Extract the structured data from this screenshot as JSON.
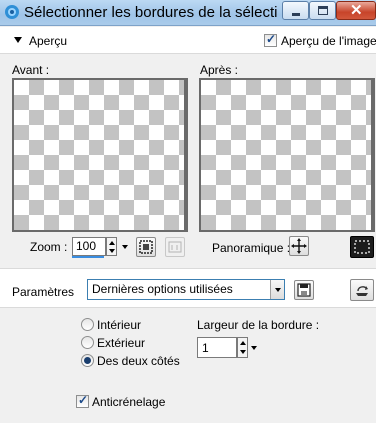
{
  "window": {
    "title": "Sélectionner les bordures de la sélecti",
    "close_glyph": "✕"
  },
  "preview": {
    "section_label": "Aperçu",
    "image_preview_label": "Aperçu de l'image",
    "image_preview_checked": true,
    "before_label": "Avant :",
    "after_label": "Après :"
  },
  "zoom": {
    "label": "Zoom :",
    "value": "100"
  },
  "pan": {
    "label": "Panoramique :"
  },
  "settings": {
    "label": "Paramètres",
    "preset_value": "Dernières options utilisées"
  },
  "options": {
    "radios": [
      {
        "label": "Intérieur",
        "checked": false
      },
      {
        "label": "Extérieur",
        "checked": false
      },
      {
        "label": "Des deux côtés",
        "checked": true
      }
    ],
    "border_width_label": "Largeur de la bordure :",
    "border_width_value": "1",
    "antialias_label": "Anticrénelage",
    "antialias_checked": true
  },
  "colors": {
    "titlebar": "#a9cbea",
    "close_button": "#c7442a",
    "checker": "#c3c3c3",
    "accent": "#3a8de0"
  },
  "icons": [
    "app-icon",
    "minimize-icon",
    "maximize-icon",
    "close-icon",
    "collapse-arrow-icon",
    "zoom-fit-icon",
    "zoom-actual-icon",
    "pan-move-icon",
    "selection-marquee-icon",
    "save-preset-icon",
    "reset-icon"
  ]
}
